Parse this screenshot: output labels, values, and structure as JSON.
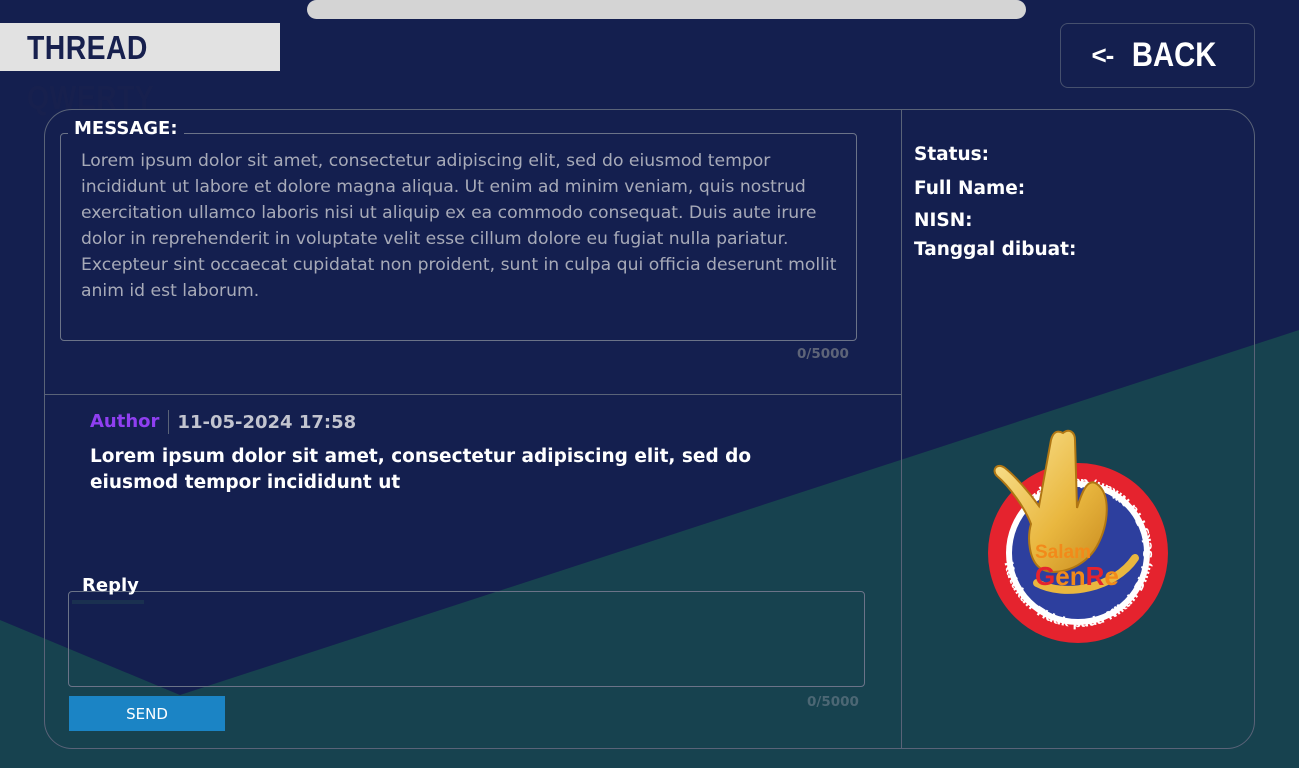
{
  "header": {
    "title": "THREAD QWERTY",
    "back_label": "BACK",
    "back_arrow": "<-"
  },
  "message": {
    "legend": "MESSAGE:",
    "text": "Lorem ipsum dolor sit amet, consectetur adipiscing elit, sed do eiusmod tempor incididunt ut labore et dolore magna aliqua. Ut enim ad minim veniam, quis nostrud exercitation ullamco laboris nisi ut aliquip ex ea commodo consequat. Duis aute irure dolor in reprehenderit in voluptate velit esse cillum dolore eu fugiat nulla pariatur. Excepteur sint occaecat cupidatat non proident, sunt in culpa qui officia deserunt mollit anim id est laborum.",
    "counter": "0/5000"
  },
  "comment": {
    "author": "Author",
    "date": "11-05-2024 17:58",
    "text": "Lorem ipsum dolor sit amet, consectetur adipiscing elit, sed do eiusmod tempor incididunt ut"
  },
  "reply": {
    "legend": "Reply",
    "value": "",
    "counter": "0/5000",
    "send_label": "SEND"
  },
  "info": {
    "status_label": "Status:",
    "fullname_label": "Full Name:",
    "nisn_label": "NISN:",
    "created_label": "Tanggal dibuat:"
  },
  "logo": {
    "line1": "Salam",
    "line2_g": "G",
    "line2_en": "en",
    "line2_r": "R",
    "line2_e": "e",
    "ring_text": "Katakan Tidak pada Nikah Dini, Seks Pra Nikah, dan Napza"
  },
  "colors": {
    "background": "#141f4f",
    "teal": "#17424f",
    "accent_blue": "#1b84c5",
    "author_purple": "#8f3ff1"
  }
}
